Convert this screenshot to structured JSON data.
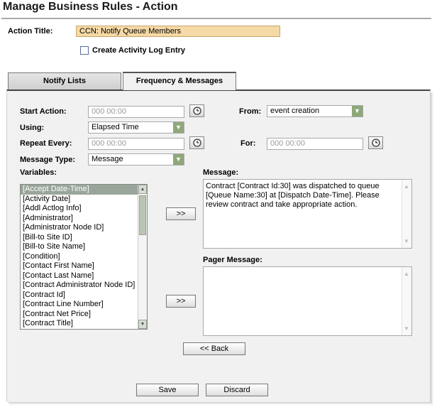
{
  "page": {
    "title": "Manage Business Rules - Action"
  },
  "action": {
    "title_label": "Action Title:",
    "title_value": "CCN: Notify Queue Members",
    "activity_log_label": "Create Activity Log Entry",
    "activity_log_checked": false
  },
  "tabs": [
    {
      "label": "Notify Lists",
      "active": false
    },
    {
      "label": "Frequency & Messages",
      "active": true
    }
  ],
  "form": {
    "start_action": {
      "label": "Start Action:",
      "placeholder": "000 00:00"
    },
    "from": {
      "label": "From:",
      "value": "event creation"
    },
    "using": {
      "label": "Using:",
      "value": "Elapsed Time"
    },
    "repeat_every": {
      "label": "Repeat Every:",
      "placeholder": "000 00:00"
    },
    "for": {
      "label": "For:",
      "placeholder": "000 00:00"
    },
    "message_type": {
      "label": "Message Type:",
      "value": "Message"
    }
  },
  "variables": {
    "label": "Variables:",
    "items": [
      "[Accept Date-Time]",
      "[Activity Date]",
      "[Addl Actlog Info]",
      "[Administrator]",
      "[Administrator Node ID]",
      "[Bill-to Site ID]",
      "[Bill-to Site Name]",
      "[Condition]",
      "[Contact First Name]",
      "[Contact Last Name]",
      "[Contract Administrator Node ID]",
      "[Contract Id]",
      "[Contract Line Number]",
      "[Contract Net Price]",
      "[Contract Title]"
    ],
    "selected_index": 0
  },
  "message": {
    "label": "Message:",
    "value": "Contract [Contract Id:30] was dispatched to queue [Queue Name:30] at [Dispatch Date-Time]. Please review contract and take appropriate action."
  },
  "pager_message": {
    "label": "Pager Message:",
    "value": ""
  },
  "buttons": {
    "insert_message": ">>",
    "insert_pager": ">>",
    "back": "<< Back",
    "save": "Save",
    "discard": "Discard"
  },
  "colors": {
    "action_title_bg": "#f5d9a6",
    "select_arrow": "#8ea87a",
    "selected_item": "#9aa59a"
  }
}
